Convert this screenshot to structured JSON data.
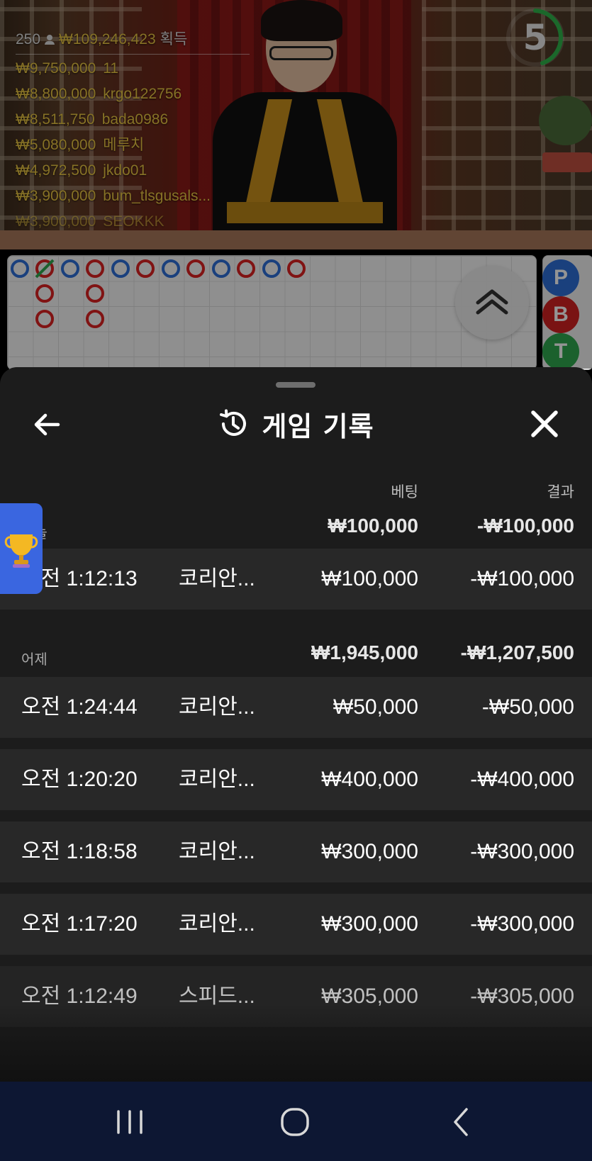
{
  "live_video": {
    "player_count": "250",
    "total_won": "₩109,246,423",
    "total_won_suffix": "획득",
    "timer": "5",
    "winners": [
      {
        "amount": "₩9,750,000",
        "name": "11"
      },
      {
        "amount": "₩8,800,000",
        "name": "krgo122756"
      },
      {
        "amount": "₩8,511,750",
        "name": "bada0986"
      },
      {
        "amount": "₩5,080,000",
        "name": "메루치"
      },
      {
        "amount": "₩4,972,500",
        "name": "jkdo01"
      },
      {
        "amount": "₩3,900,000",
        "name": "bum_tlsgusals..."
      },
      {
        "amount": "₩3,900,000",
        "name": "SEOKKK"
      }
    ]
  },
  "side_panel": {
    "player": "P",
    "banker": "B",
    "tie": "T"
  },
  "colors": {
    "player_blue": "#2e6fd8",
    "banker_red": "#d22222",
    "tie_green": "#2fa84f",
    "accent_gold": "#e8c542"
  },
  "history": {
    "title": "게임 기록",
    "columns": {
      "bet": "베팅",
      "result": "결과"
    },
    "groups": [
      {
        "label": "오늘",
        "bet_total": "₩100,000",
        "result_total": "-₩100,000",
        "rows": [
          {
            "time": "오전 1:12:13",
            "game": "코리안...",
            "bet": "₩100,000",
            "result": "-₩100,000"
          }
        ]
      },
      {
        "label": "어제",
        "bet_total": "₩1,945,000",
        "result_total": "-₩1,207,500",
        "rows": [
          {
            "time": "오전 1:24:44",
            "game": "코리안...",
            "bet": "₩50,000",
            "result": "-₩50,000"
          },
          {
            "time": "오전 1:20:20",
            "game": "코리안...",
            "bet": "₩400,000",
            "result": "-₩400,000"
          },
          {
            "time": "오전 1:18:58",
            "game": "코리안...",
            "bet": "₩300,000",
            "result": "-₩300,000"
          },
          {
            "time": "오전 1:17:20",
            "game": "코리안...",
            "bet": "₩300,000",
            "result": "-₩300,000"
          },
          {
            "time": "오전 1:12:49",
            "game": "스피드...",
            "bet": "₩305,000",
            "result": "-₩305,000"
          }
        ]
      }
    ]
  },
  "icons": {
    "back": "arrow-left-icon",
    "close": "close-icon",
    "history": "history-clock-icon",
    "scroll_up": "double-chevron-up-icon",
    "trophy": "trophy-icon"
  }
}
